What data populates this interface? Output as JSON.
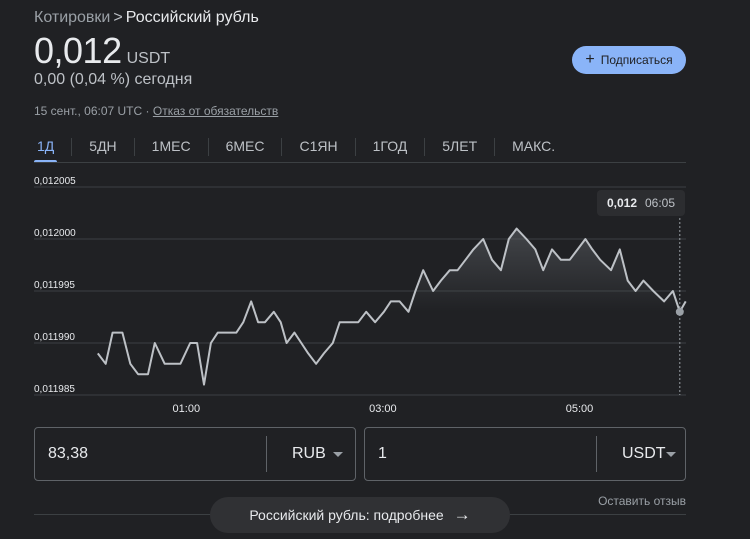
{
  "breadcrumb": {
    "parent": "Котировки",
    "separator": ">",
    "current": "Российский рубль"
  },
  "price": {
    "value": "0,012",
    "unit": "USDT"
  },
  "change": {
    "text": "0,00 (0,04 %) сегодня"
  },
  "subscribe": {
    "icon": "plus-icon",
    "label": "Подписаться"
  },
  "meta": {
    "timestamp": "15 сент., 06:07 UTC",
    "separator": "·",
    "disclaimer": "Отказ от обязательств"
  },
  "tabs": [
    {
      "label": "1Д",
      "active": true
    },
    {
      "label": "5ДН",
      "active": false
    },
    {
      "label": "1МЕС",
      "active": false
    },
    {
      "label": "6МЕС",
      "active": false
    },
    {
      "label": "С1ЯН",
      "active": false
    },
    {
      "label": "1ГОД",
      "active": false
    },
    {
      "label": "5ЛЕТ",
      "active": false
    },
    {
      "label": "МАКС.",
      "active": false
    }
  ],
  "tooltip": {
    "value": "0,012",
    "time": "06:05"
  },
  "chart_data": {
    "type": "line",
    "ylim": [
      0.011985,
      0.012005
    ],
    "yticks": [
      "0,012005",
      "0,012000",
      "0,011995",
      "0,011990",
      "0,011985"
    ],
    "ytick_values": [
      0.012005,
      0.012,
      0.011995,
      0.01199,
      0.011985
    ],
    "xlim": [
      0,
      6.083
    ],
    "xticks": [
      "01:00",
      "03:00",
      "05:00"
    ],
    "xtick_values": [
      1,
      3,
      5
    ],
    "grid": true,
    "line_color": "#bdc1c6",
    "series": [
      {
        "x": [
          0.1,
          0.18,
          0.25,
          0.35,
          0.43,
          0.51,
          0.61,
          0.68,
          0.78,
          0.86,
          0.94,
          1.04,
          1.11,
          1.18,
          1.25,
          1.32,
          1.42,
          1.51,
          1.58,
          1.66,
          1.73,
          1.8,
          1.89,
          1.96,
          2.02,
          2.1,
          2.17,
          2.24,
          2.32,
          2.4,
          2.49,
          2.56,
          2.66,
          2.75,
          2.83,
          2.92,
          3.01,
          3.08,
          3.17,
          3.26,
          3.33,
          3.41,
          3.51,
          3.59,
          3.68,
          3.76,
          3.84,
          3.92,
          4.02,
          4.11,
          4.2,
          4.28,
          4.36,
          4.46,
          4.55,
          4.63,
          4.72,
          4.81,
          4.9,
          4.98,
          5.06,
          5.13,
          5.21,
          5.32,
          5.41,
          5.49,
          5.57,
          5.65,
          5.75,
          5.86,
          5.95,
          6.02,
          6.08
        ],
        "y": [
          0.011989,
          0.011988,
          0.011991,
          0.011991,
          0.011988,
          0.011987,
          0.011987,
          0.01199,
          0.011988,
          0.011988,
          0.011988,
          0.01199,
          0.01199,
          0.011986,
          0.01199,
          0.011991,
          0.011991,
          0.011991,
          0.011992,
          0.011994,
          0.011992,
          0.011992,
          0.011993,
          0.011992,
          0.01199,
          0.011991,
          0.01199,
          0.011989,
          0.011988,
          0.011989,
          0.01199,
          0.011992,
          0.011992,
          0.011992,
          0.011993,
          0.011992,
          0.011993,
          0.011994,
          0.011994,
          0.011993,
          0.011995,
          0.011997,
          0.011995,
          0.011996,
          0.011997,
          0.011997,
          0.011998,
          0.011999,
          0.012,
          0.011998,
          0.011997,
          0.012,
          0.012001,
          0.012,
          0.011999,
          0.011997,
          0.011999,
          0.011998,
          0.011998,
          0.011999,
          0.012,
          0.011999,
          0.011998,
          0.011997,
          0.011999,
          0.011996,
          0.011995,
          0.011996,
          0.011995,
          0.011994,
          0.011995,
          0.011993,
          0.011994
        ]
      }
    ]
  },
  "converter": {
    "from": {
      "value": "83,38",
      "currency": "RUB"
    },
    "to": {
      "value": "1",
      "currency": "USDT"
    }
  },
  "feedback": {
    "label": "Оставить отзыв"
  },
  "more": {
    "label": "Российский рубль: подробнее",
    "icon": "arrow-right-icon"
  }
}
